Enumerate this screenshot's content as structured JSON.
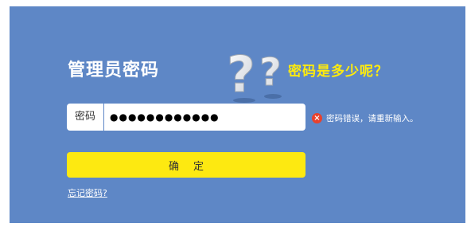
{
  "login": {
    "title": "管理员密码",
    "hint": "密码是多少呢？",
    "password_label": "密码",
    "password_value": "●●●●●●●●●●●●",
    "error_message": "密码错误，请重新输入。",
    "confirm_label": "确定",
    "forgot_link": "忘记密码?"
  },
  "colors": {
    "background": "#5e87c6",
    "hint": "#ffeb0d",
    "button": "#fde911",
    "error_icon": "#e8412c"
  },
  "icons": {
    "decoration": "question-marks-icon",
    "error": "error-icon"
  }
}
